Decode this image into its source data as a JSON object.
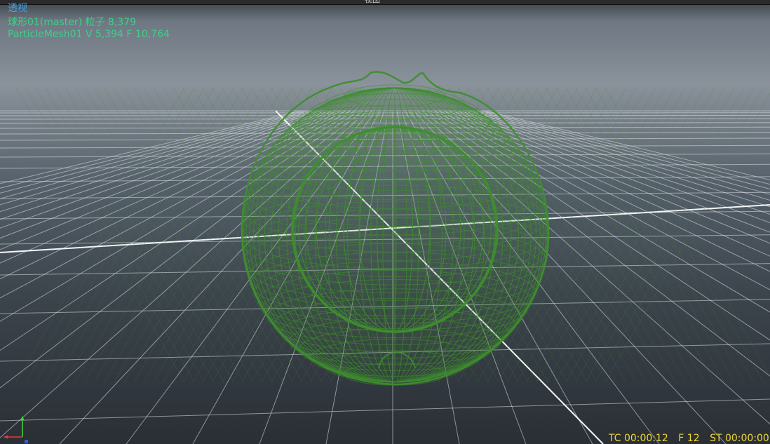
{
  "window": {
    "title": "视图"
  },
  "hud": {
    "view_name": "透视",
    "line1": "球形01(master) 粒子 8,379",
    "line2": "ParticleMesh01 V 5,394 F 10,764"
  },
  "timecode": {
    "tc": "TC 00:00:12",
    "frame": "F 12",
    "st": "ST 00:00:00"
  },
  "colors": {
    "mesh": "#3f8f2f",
    "grid": "#e6e9ec",
    "hud_view": "#3fa2e6",
    "hud_stats": "#3fcf8a",
    "timecode": "#f0d830"
  },
  "icons": {
    "axis": "axis-gizmo-icon"
  }
}
